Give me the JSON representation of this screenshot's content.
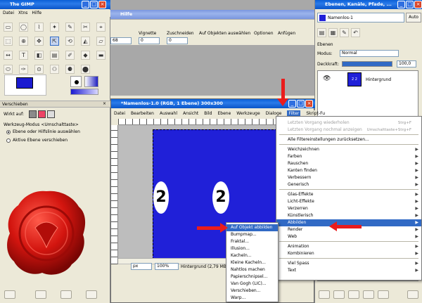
{
  "toolbox": {
    "title": "The GIMP",
    "menu": [
      "Datei",
      "Xtns",
      "Hilfe"
    ],
    "panel_title": "Verschieben",
    "affects_label": "Wirkt auf:",
    "mode_label": "Werkzeug-Modus",
    "mode_key": "<Umschalttaste>",
    "option1": "Ebene oder Hilfslinie auswählen",
    "option2": "Aktive Ebene verschieben",
    "seal_text": "Gewonnen"
  },
  "layers": {
    "title": "Ebenen, Kanäle, Pfade, ...",
    "image_select": "Namenlos-1",
    "auto_label": "Auto",
    "panel_title": "Ebenen",
    "mode_label": "Modus:",
    "mode_value": "Normal",
    "opacity_label": "Deckkraft:",
    "opacity_value": "100,0",
    "layer_name": "Hintergrund"
  },
  "behind": {
    "title": "Hilfe",
    "labels": [
      "Vignette",
      "Zuschneiden",
      "Auf Objekten auswählen",
      "Optionen",
      "Anfügen"
    ],
    "values": [
      "68",
      "0",
      "0"
    ]
  },
  "image_window": {
    "title": "*Namenlos-1.0 (RGB, 1 Ebene) 300x300",
    "menu": [
      "Datei",
      "Bearbeiten",
      "Auswahl",
      "Ansicht",
      "Bild",
      "Ebene",
      "Werkzeuge",
      "Dialoge",
      "Filter",
      "Skript-Fu"
    ],
    "digit": "2",
    "unit": "px",
    "zoom": "100%",
    "status": "Hintergrund (2,79 MB)"
  },
  "filter_menu": {
    "items": [
      {
        "label": "Letzten Vorgang wiederholen",
        "shortcut": "Strg+F",
        "disabled": true
      },
      {
        "label": "Letzten Vorgang nochmal anzeigen",
        "shortcut": "Umschalttaste+Strg+F",
        "disabled": true
      },
      {
        "label": "Alle Filtereinstellungen zurücksetzen...",
        "shortcut": "",
        "disabled": false
      },
      {
        "label": "Weichzeichnen",
        "sub": true
      },
      {
        "label": "Farben",
        "sub": true
      },
      {
        "label": "Rauschen",
        "sub": true
      },
      {
        "label": "Kanten finden",
        "sub": true
      },
      {
        "label": "Verbessern",
        "sub": true
      },
      {
        "label": "Generisch",
        "sub": true
      },
      {
        "label": "Glas-Effekte",
        "sub": true
      },
      {
        "label": "Licht-Effekte",
        "sub": true
      },
      {
        "label": "Verzerren",
        "sub": true
      },
      {
        "label": "Künstlerisch",
        "sub": true
      },
      {
        "label": "Abbilden",
        "sub": true,
        "highlight": true
      },
      {
        "label": "Render",
        "sub": true
      },
      {
        "label": "Web",
        "sub": true
      },
      {
        "label": "Animation",
        "sub": true
      },
      {
        "label": "Kombinieren",
        "sub": true
      },
      {
        "label": "Viel Spass",
        "sub": true
      },
      {
        "label": "Text",
        "sub": true
      }
    ]
  },
  "submenu": {
    "items": [
      "Auf Objekt abbilden",
      "Bumpmap...",
      "Fraktal...",
      "Illusion...",
      "Kacheln...",
      "Kleine Kacheln...",
      "Nahtlos machen",
      "Papierschnipsel...",
      "Van Gogh (LIC)...",
      "Verschieben...",
      "Warp..."
    ]
  },
  "colors": {
    "accent": "#2020d8",
    "highlight": "#316ac5",
    "arrow": "#ea1c1c",
    "seal": "#c8120e"
  }
}
